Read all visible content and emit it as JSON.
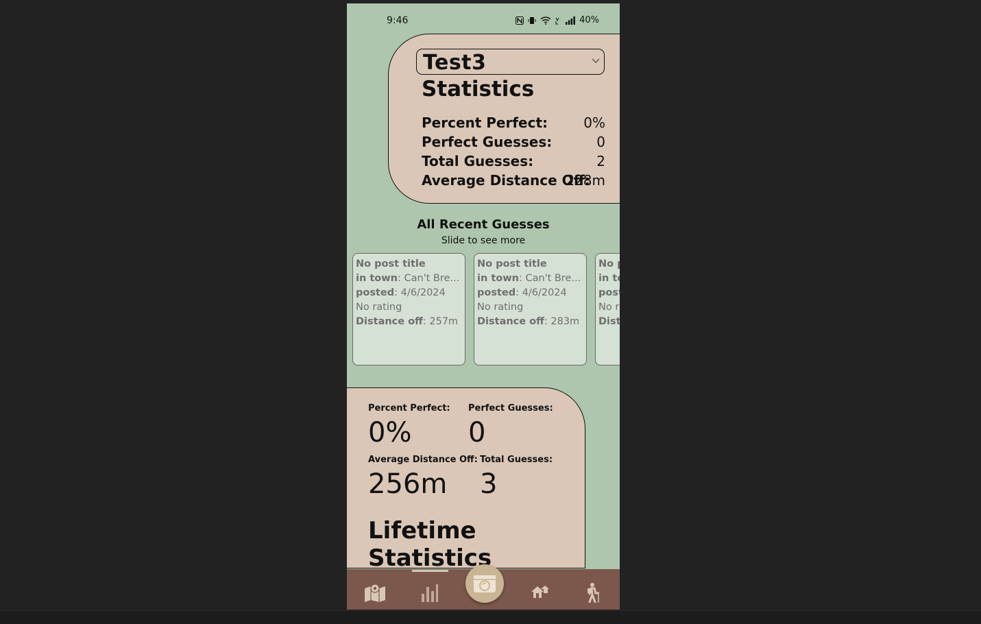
{
  "status_bar": {
    "time": "9:46",
    "battery": "40%"
  },
  "user_select": {
    "value": "Test3"
  },
  "statistics": {
    "title": "Statistics",
    "rows": [
      {
        "label": "Percent Perfect:",
        "value": "0%"
      },
      {
        "label": "Perfect Guesses:",
        "value": "0"
      },
      {
        "label": "Total Guesses:",
        "value": "2"
      },
      {
        "label": "Average Distance Off:",
        "value": "228m"
      }
    ]
  },
  "recent": {
    "title": "All Recent Guesses",
    "subtitle": "Slide to see more",
    "cards": [
      {
        "title": "No post title",
        "town_label": "in town",
        "town": ": Can't Bre...",
        "posted_label": "posted",
        "posted": ": 4/6/2024",
        "rating": "No rating",
        "distance_label": "Distance off",
        "distance": ": 257m"
      },
      {
        "title": "No post title",
        "town_label": "in town",
        "town": ": Can't Bre...",
        "posted_label": "posted",
        "posted": ": 4/6/2024",
        "rating": "No rating",
        "distance_label": "Distance off",
        "distance": ": 283m"
      },
      {
        "title": "No po",
        "town_label": "in to",
        "town": "",
        "posted_label": "post",
        "posted": "",
        "rating": "No ra",
        "distance_label": "Dista",
        "distance": ""
      }
    ]
  },
  "lifetime": {
    "title": "Lifetime Statistics",
    "percent_perfect_label": "Percent Perfect:",
    "percent_perfect": "0%",
    "perfect_guesses_label": "Perfect Guesses:",
    "perfect_guesses": "0",
    "avg_distance_label": "Average Distance Off:",
    "avg_distance": "256m",
    "total_guesses_label": "Total Guesses:",
    "total_guesses": "3"
  },
  "nav": {
    "items": [
      "map-icon",
      "stats-icon",
      "camera-icon",
      "home-icon",
      "hiker-icon"
    ],
    "active": "stats-icon",
    "colors": {
      "bar": "#7b584b",
      "icon": "#d9c7b6",
      "center": "#c9b594"
    }
  },
  "colors": {
    "background": "#adc6ad",
    "card": "#dbc7b7",
    "guess_card": "#d6e1d6"
  }
}
